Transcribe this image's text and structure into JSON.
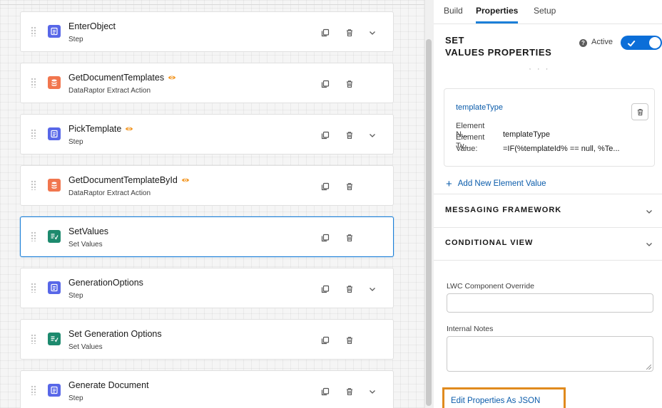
{
  "steps": [
    {
      "name": "EnterObject",
      "type": "Step",
      "icon": "list-icon",
      "eye": false,
      "chevron": true
    },
    {
      "name": "GetDocumentTemplates",
      "type": "DataRaptor Extract Action",
      "icon": "database-icon",
      "eye": true,
      "chevron": false
    },
    {
      "name": "PickTemplate",
      "type": "Step",
      "icon": "list-icon",
      "eye": true,
      "chevron": true
    },
    {
      "name": "GetDocumentTemplateById",
      "type": "DataRaptor Extract Action",
      "icon": "database-icon",
      "eye": true,
      "chevron": false
    },
    {
      "name": "SetValues",
      "type": "Set Values",
      "icon": "set-values-icon",
      "eye": false,
      "chevron": false,
      "selected": true
    },
    {
      "name": "GenerationOptions",
      "type": "Step",
      "icon": "list-icon",
      "eye": false,
      "chevron": true
    },
    {
      "name": "Set Generation Options",
      "type": "Set Values",
      "icon": "set-values-icon",
      "eye": false,
      "chevron": false
    },
    {
      "name": "Generate Document",
      "type": "Step",
      "icon": "list-icon",
      "eye": false,
      "chevron": true
    }
  ],
  "panel": {
    "tabs": [
      "Build",
      "Properties",
      "Setup"
    ],
    "active_tab": "Properties",
    "title_line1": "SET",
    "title_line2": "VALUES PROPERTIES",
    "active_label": "Active",
    "active_on": true,
    "truncated_text": ", , ,",
    "element": {
      "name_link": "templateType",
      "name_key": "Element N...",
      "name_value": "templateType",
      "type_key": "Element Ty...",
      "type_value": "",
      "value_key": "Value:",
      "value_value": "=IF(%templateId% == null, %Te..."
    },
    "add_element_label": "Add New Element Value",
    "sections": [
      "MESSAGING FRAMEWORK",
      "CONDITIONAL VIEW"
    ],
    "lwc_label": "LWC Component Override",
    "lwc_value": "",
    "notes_label": "Internal Notes",
    "notes_value": "",
    "json_button": "Edit Properties As JSON"
  },
  "colors": {
    "accent": "#1b7fd8",
    "step_icon": "#5867e8",
    "dataraptor_icon": "#f1764e",
    "set_values_icon": "#1d8a6e",
    "highlight_border": "#e08a1e",
    "link": "#0b5cab"
  }
}
